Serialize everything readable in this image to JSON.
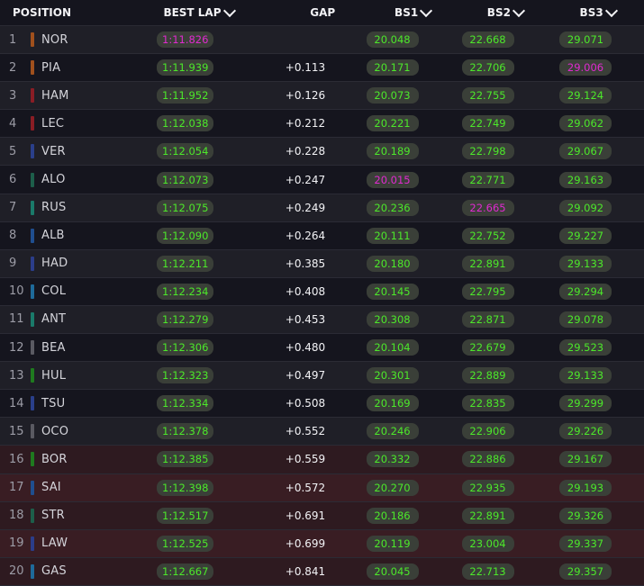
{
  "header": {
    "position": "POSITION",
    "best_lap": "BEST LAP",
    "gap": "GAP",
    "bs1": "BS1",
    "bs2": "BS2",
    "bs3": "BS3"
  },
  "colors": {
    "green": "#4ce82a",
    "purple": "#e02ad0",
    "pill_bg": "#3a3f38",
    "eliminated_row": "#391d23"
  },
  "rows": [
    {
      "pos": "1",
      "driver": "NOR",
      "team_color": "#a0501d",
      "best_lap": "1:11.826",
      "best_lap_purple": true,
      "gap": "",
      "bs1": "20.048",
      "bs1_purple": false,
      "bs2": "22.668",
      "bs2_purple": false,
      "bs3": "29.071",
      "bs3_purple": false,
      "eliminated": false
    },
    {
      "pos": "2",
      "driver": "PIA",
      "team_color": "#a0501d",
      "best_lap": "1:11.939",
      "best_lap_purple": false,
      "gap": "+0.113",
      "bs1": "20.171",
      "bs1_purple": false,
      "bs2": "22.706",
      "bs2_purple": false,
      "bs3": "29.006",
      "bs3_purple": true,
      "eliminated": false
    },
    {
      "pos": "3",
      "driver": "HAM",
      "team_color": "#8a1d25",
      "best_lap": "1:11.952",
      "best_lap_purple": false,
      "gap": "+0.126",
      "bs1": "20.073",
      "bs1_purple": false,
      "bs2": "22.755",
      "bs2_purple": false,
      "bs3": "29.124",
      "bs3_purple": false,
      "eliminated": false
    },
    {
      "pos": "4",
      "driver": "LEC",
      "team_color": "#8a1d25",
      "best_lap": "1:12.038",
      "best_lap_purple": false,
      "gap": "+0.212",
      "bs1": "20.221",
      "bs1_purple": false,
      "bs2": "22.749",
      "bs2_purple": false,
      "bs3": "29.062",
      "bs3_purple": false,
      "eliminated": false
    },
    {
      "pos": "5",
      "driver": "VER",
      "team_color": "#2a3f8a",
      "best_lap": "1:12.054",
      "best_lap_purple": false,
      "gap": "+0.228",
      "bs1": "20.189",
      "bs1_purple": false,
      "bs2": "22.798",
      "bs2_purple": false,
      "bs3": "29.067",
      "bs3_purple": false,
      "eliminated": false
    },
    {
      "pos": "6",
      "driver": "ALO",
      "team_color": "#1d5e4a",
      "best_lap": "1:12.073",
      "best_lap_purple": false,
      "gap": "+0.247",
      "bs1": "20.015",
      "bs1_purple": true,
      "bs2": "22.771",
      "bs2_purple": false,
      "bs3": "29.163",
      "bs3_purple": false,
      "eliminated": false
    },
    {
      "pos": "7",
      "driver": "RUS",
      "team_color": "#1a7a6a",
      "best_lap": "1:12.075",
      "best_lap_purple": false,
      "gap": "+0.249",
      "bs1": "20.236",
      "bs1_purple": false,
      "bs2": "22.665",
      "bs2_purple": true,
      "bs3": "29.092",
      "bs3_purple": false,
      "eliminated": false
    },
    {
      "pos": "8",
      "driver": "ALB",
      "team_color": "#1f4e8f",
      "best_lap": "1:12.090",
      "best_lap_purple": false,
      "gap": "+0.264",
      "bs1": "20.111",
      "bs1_purple": false,
      "bs2": "22.752",
      "bs2_purple": false,
      "bs3": "29.227",
      "bs3_purple": false,
      "eliminated": false
    },
    {
      "pos": "9",
      "driver": "HAD",
      "team_color": "#2b3d8a",
      "best_lap": "1:12.211",
      "best_lap_purple": false,
      "gap": "+0.385",
      "bs1": "20.180",
      "bs1_purple": false,
      "bs2": "22.891",
      "bs2_purple": false,
      "bs3": "29.133",
      "bs3_purple": false,
      "eliminated": false
    },
    {
      "pos": "10",
      "driver": "COL",
      "team_color": "#1e6a9a",
      "best_lap": "1:12.234",
      "best_lap_purple": false,
      "gap": "+0.408",
      "bs1": "20.145",
      "bs1_purple": false,
      "bs2": "22.795",
      "bs2_purple": false,
      "bs3": "29.294",
      "bs3_purple": false,
      "eliminated": false
    },
    {
      "pos": "11",
      "driver": "ANT",
      "team_color": "#1a7a6a",
      "best_lap": "1:12.279",
      "best_lap_purple": false,
      "gap": "+0.453",
      "bs1": "20.308",
      "bs1_purple": false,
      "bs2": "22.871",
      "bs2_purple": false,
      "bs3": "29.078",
      "bs3_purple": false,
      "eliminated": false
    },
    {
      "pos": "12",
      "driver": "BEA",
      "team_color": "#5a5a62",
      "best_lap": "1:12.306",
      "best_lap_purple": false,
      "gap": "+0.480",
      "bs1": "20.104",
      "bs1_purple": false,
      "bs2": "22.679",
      "bs2_purple": false,
      "bs3": "29.523",
      "bs3_purple": false,
      "eliminated": false
    },
    {
      "pos": "13",
      "driver": "HUL",
      "team_color": "#1f7a1f",
      "best_lap": "1:12.323",
      "best_lap_purple": false,
      "gap": "+0.497",
      "bs1": "20.301",
      "bs1_purple": false,
      "bs2": "22.889",
      "bs2_purple": false,
      "bs3": "29.133",
      "bs3_purple": false,
      "eliminated": false
    },
    {
      "pos": "14",
      "driver": "TSU",
      "team_color": "#2a3f8a",
      "best_lap": "1:12.334",
      "best_lap_purple": false,
      "gap": "+0.508",
      "bs1": "20.169",
      "bs1_purple": false,
      "bs2": "22.835",
      "bs2_purple": false,
      "bs3": "29.299",
      "bs3_purple": false,
      "eliminated": false
    },
    {
      "pos": "15",
      "driver": "OCO",
      "team_color": "#5a5a62",
      "best_lap": "1:12.378",
      "best_lap_purple": false,
      "gap": "+0.552",
      "bs1": "20.246",
      "bs1_purple": false,
      "bs2": "22.906",
      "bs2_purple": false,
      "bs3": "29.226",
      "bs3_purple": false,
      "eliminated": false
    },
    {
      "pos": "16",
      "driver": "BOR",
      "team_color": "#1f7a1f",
      "best_lap": "1:12.385",
      "best_lap_purple": false,
      "gap": "+0.559",
      "bs1": "20.332",
      "bs1_purple": false,
      "bs2": "22.886",
      "bs2_purple": false,
      "bs3": "29.167",
      "bs3_purple": false,
      "eliminated": true
    },
    {
      "pos": "17",
      "driver": "SAI",
      "team_color": "#1f4e8f",
      "best_lap": "1:12.398",
      "best_lap_purple": false,
      "gap": "+0.572",
      "bs1": "20.270",
      "bs1_purple": false,
      "bs2": "22.935",
      "bs2_purple": false,
      "bs3": "29.193",
      "bs3_purple": false,
      "eliminated": true
    },
    {
      "pos": "18",
      "driver": "STR",
      "team_color": "#1d5e4a",
      "best_lap": "1:12.517",
      "best_lap_purple": false,
      "gap": "+0.691",
      "bs1": "20.186",
      "bs1_purple": false,
      "bs2": "22.891",
      "bs2_purple": false,
      "bs3": "29.326",
      "bs3_purple": false,
      "eliminated": true
    },
    {
      "pos": "19",
      "driver": "LAW",
      "team_color": "#2b3d8a",
      "best_lap": "1:12.525",
      "best_lap_purple": false,
      "gap": "+0.699",
      "bs1": "20.119",
      "bs1_purple": false,
      "bs2": "23.004",
      "bs2_purple": false,
      "bs3": "29.337",
      "bs3_purple": false,
      "eliminated": true
    },
    {
      "pos": "20",
      "driver": "GAS",
      "team_color": "#1e6a9a",
      "best_lap": "1:12.667",
      "best_lap_purple": false,
      "gap": "+0.841",
      "bs1": "20.045",
      "bs1_purple": false,
      "bs2": "22.713",
      "bs2_purple": false,
      "bs3": "29.357",
      "bs3_purple": false,
      "eliminated": true
    }
  ]
}
